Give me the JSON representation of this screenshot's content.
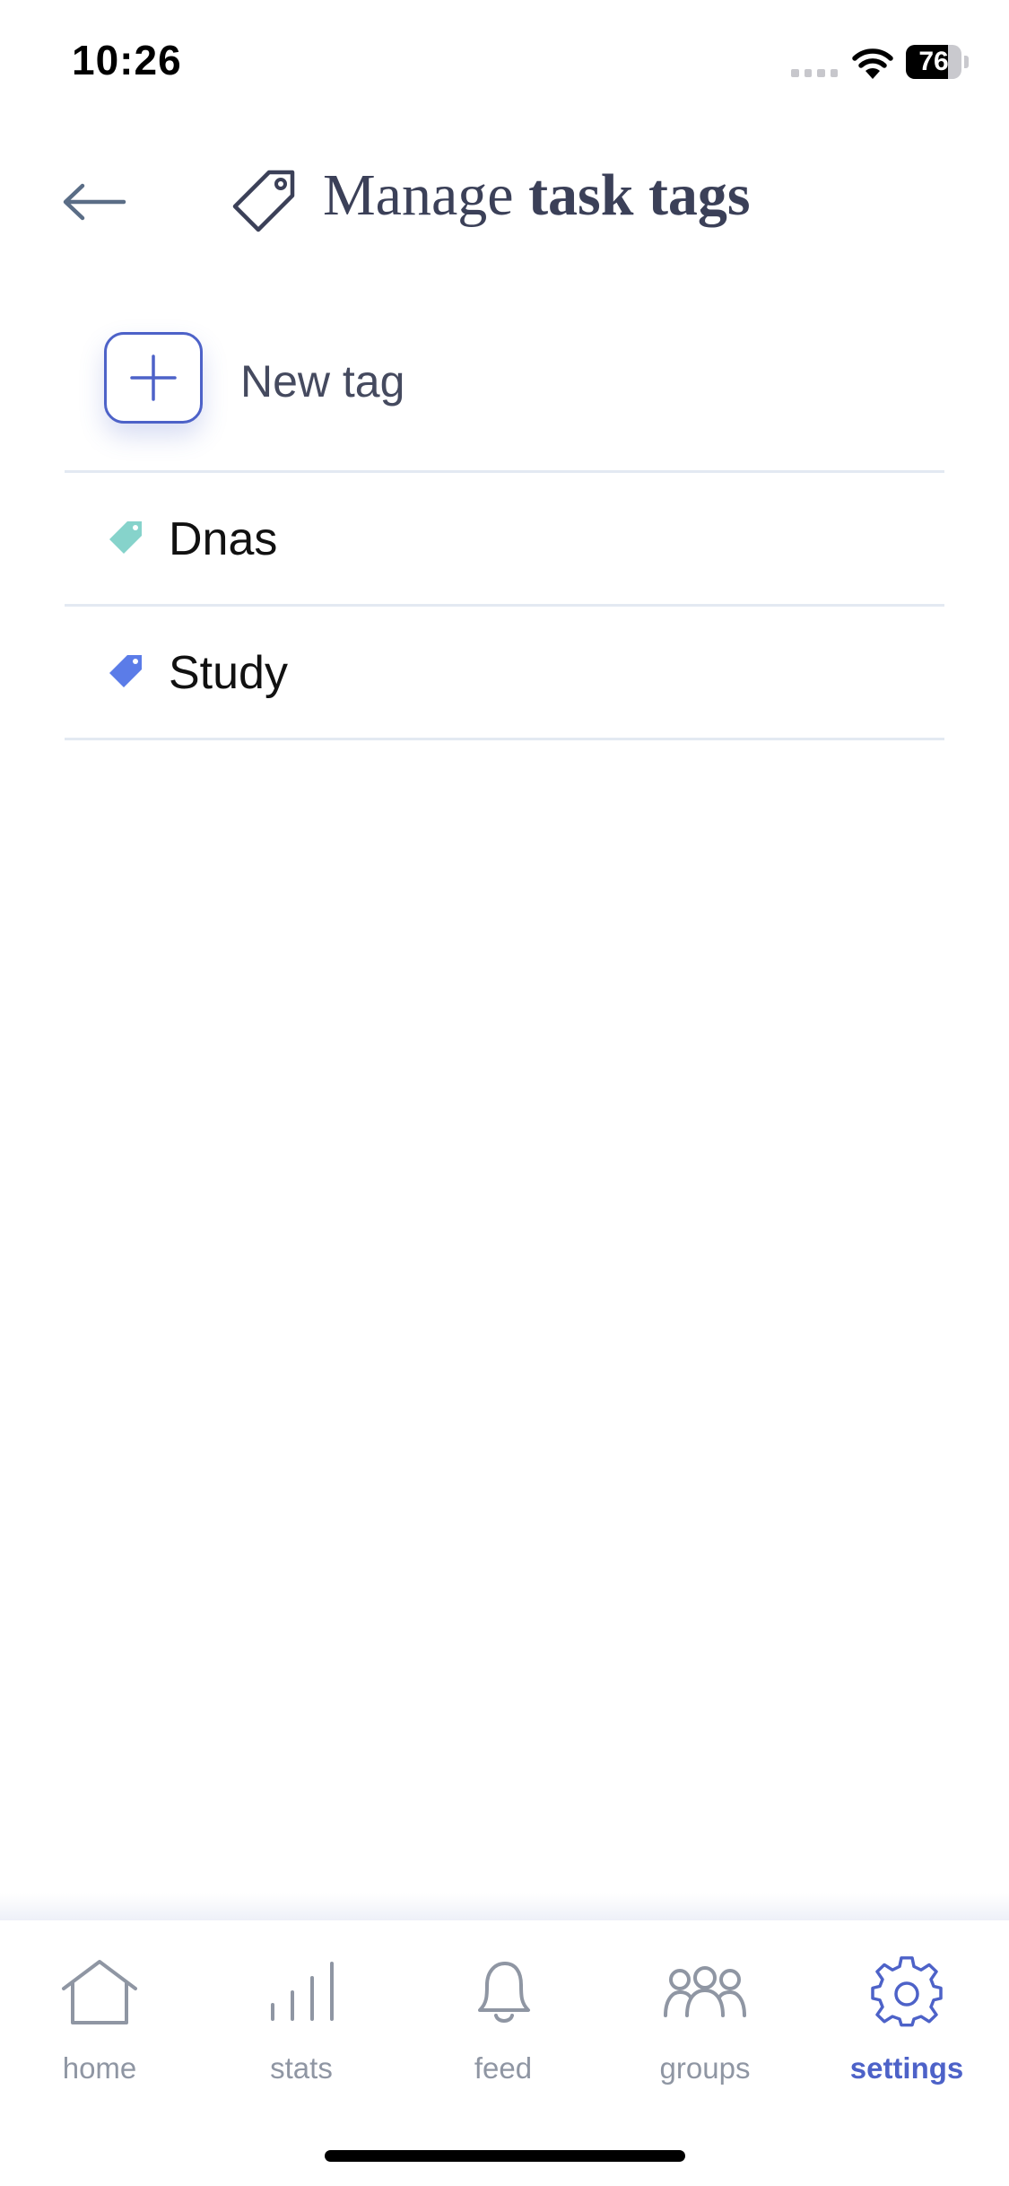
{
  "status_bar": {
    "time": "10:26",
    "battery": "76",
    "battery_level": 0.76
  },
  "header": {
    "back_icon": "arrow-left-icon",
    "title_icon": "tag-outline-icon",
    "title_regular": "Manage ",
    "title_bold": "task tags"
  },
  "new_tag": {
    "icon": "plus-icon",
    "label": "New tag",
    "accent_color": "#4d62c8"
  },
  "tags": [
    {
      "label": "Dnas",
      "color": "#86d3cb",
      "icon": "tag-icon"
    },
    {
      "label": "Study",
      "color": "#5b7ce8",
      "icon": "tag-icon"
    }
  ],
  "bottom_nav": {
    "items": [
      {
        "label": "home",
        "icon": "home-icon",
        "active": false
      },
      {
        "label": "stats",
        "icon": "stats-bars-icon",
        "active": false
      },
      {
        "label": "feed",
        "icon": "bell-icon",
        "active": false
      },
      {
        "label": "groups",
        "icon": "groups-icon",
        "active": false
      },
      {
        "label": "settings",
        "icon": "gear-icon",
        "active": true
      }
    ],
    "active_color": "#4d62c8",
    "inactive_color": "#8f96a3"
  }
}
